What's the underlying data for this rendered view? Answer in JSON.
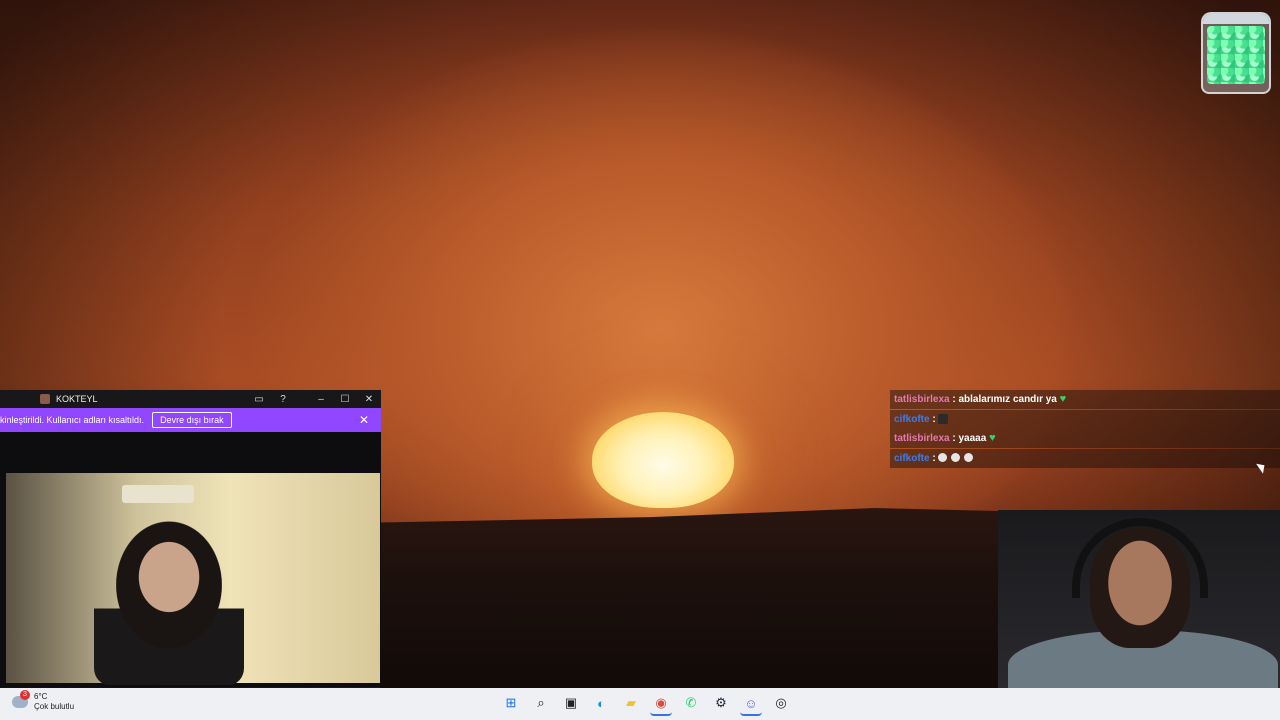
{
  "chat": [
    {
      "user": "tatlisbirlexa",
      "sep": " : ",
      "message": "ablalarımız candır ya",
      "emote": "heart",
      "color": "pink"
    },
    {
      "user": "cifkofte",
      "sep": " : ",
      "message": "",
      "emote": "square",
      "color": "blue"
    },
    {
      "user": "tatlisbirlexa",
      "sep": " : ",
      "message": "yaaaa",
      "emote": "heart",
      "color": "pink"
    },
    {
      "user": "cifkofte",
      "sep": " : ",
      "message": "",
      "emote": "faces",
      "color": "blue"
    }
  ],
  "window": {
    "title": "KOKTEYL",
    "notice_text": "kinleştirildi. Kullanıcı adları kısaltıldı.",
    "notice_button": "Devre dışı bırak",
    "close_glyph": "✕",
    "minimize_glyph": "–",
    "maximize_glyph": "☐",
    "theater_glyph": "▭",
    "help_glyph": "?"
  },
  "weather": {
    "temp": "6°C",
    "desc": "Çok bulutlu",
    "badge": "3"
  },
  "taskbar_apps": [
    {
      "name": "start-icon",
      "glyph": "⊞",
      "color": "#1a73e8"
    },
    {
      "name": "search-icon",
      "glyph": "⌕",
      "color": "#222"
    },
    {
      "name": "task-view-icon",
      "glyph": "▣",
      "color": "#222"
    },
    {
      "name": "edge-icon",
      "glyph": "◐",
      "color": "#1a8fd1"
    },
    {
      "name": "file-explorer-icon",
      "glyph": "▰",
      "color": "#f2c030"
    },
    {
      "name": "chrome-icon",
      "glyph": "◉",
      "color": "#dd4b3e"
    },
    {
      "name": "whatsapp-icon",
      "glyph": "✆",
      "color": "#25d366"
    },
    {
      "name": "steam-icon",
      "glyph": "⚙",
      "color": "#1b2838"
    },
    {
      "name": "discord-icon",
      "glyph": "☺",
      "color": "#5865f2"
    },
    {
      "name": "obs-icon",
      "glyph": "◎",
      "color": "#222"
    }
  ],
  "colors": {
    "chat_user_pink": "#e07ab0",
    "chat_user_blue": "#3a7cf0",
    "notice_bg": "#9146ff",
    "heart": "#34d36a"
  }
}
